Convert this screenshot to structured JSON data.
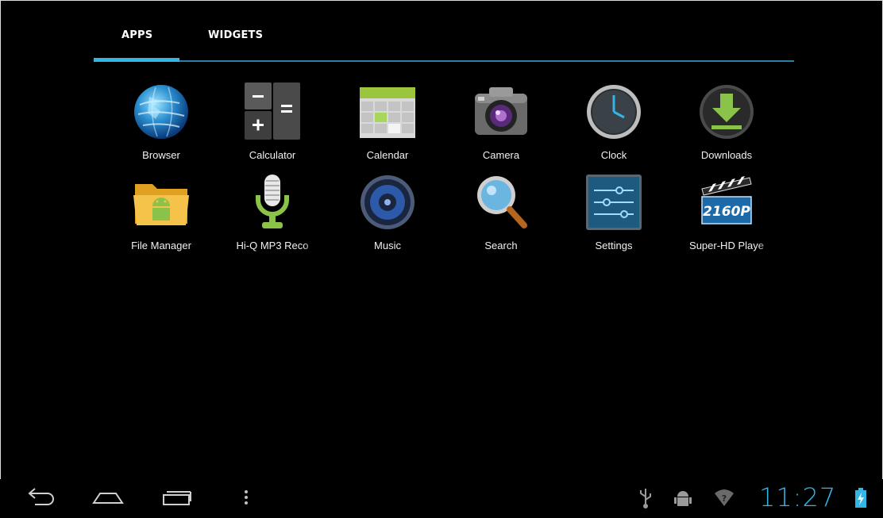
{
  "tabs": {
    "apps": "APPS",
    "widgets": "WIDGETS"
  },
  "apps": [
    {
      "label": "Browser",
      "icon": "browser-icon"
    },
    {
      "label": "Calculator",
      "icon": "calculator-icon"
    },
    {
      "label": "Calendar",
      "icon": "calendar-icon"
    },
    {
      "label": "Camera",
      "icon": "camera-icon"
    },
    {
      "label": "Clock",
      "icon": "clock-icon"
    },
    {
      "label": "Downloads",
      "icon": "downloads-icon"
    },
    {
      "label": "File Manager",
      "icon": "file-manager-icon"
    },
    {
      "label": "Hi-Q MP3 Reco",
      "icon": "microphone-icon"
    },
    {
      "label": "Music",
      "icon": "music-icon"
    },
    {
      "label": "Search",
      "icon": "search-icon"
    },
    {
      "label": "Settings",
      "icon": "settings-icon"
    },
    {
      "label": "Super-HD Playe",
      "icon": "super-hd-player-icon"
    }
  ],
  "super_hd_badge": "2160P",
  "status": {
    "time": "11:27"
  },
  "colors": {
    "accent": "#33b5e5",
    "background": "#000000"
  }
}
